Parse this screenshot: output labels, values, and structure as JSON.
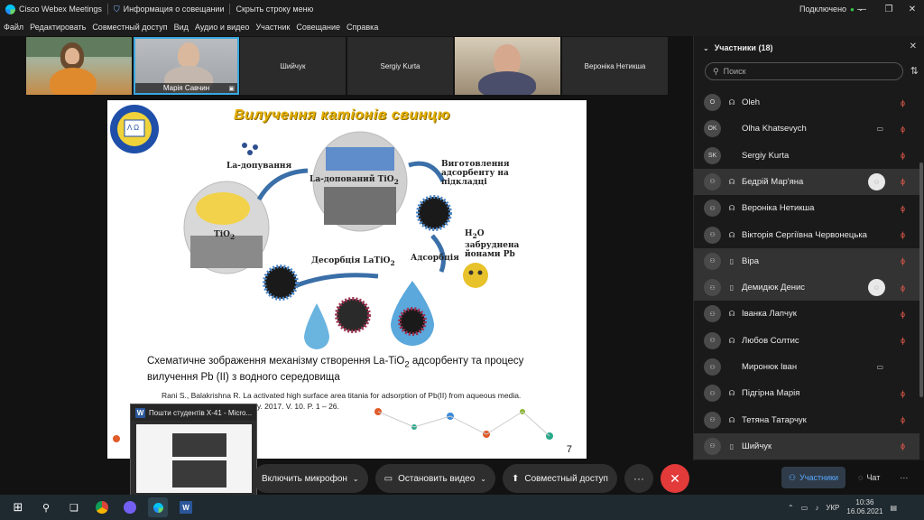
{
  "titlebar": {
    "app_title": "Cisco Webex Meetings",
    "meeting_info": "Информация о совещании",
    "hide_menu": "Скрыть строку меню",
    "status": "Подключено"
  },
  "menu": [
    "Файл",
    "Редактировать",
    "Совместный доступ",
    "Вид",
    "Аудио и видео",
    "Участник",
    "Совещание",
    "Справка"
  ],
  "tiles": [
    {
      "name": "",
      "type": "video"
    },
    {
      "name": "Марія Савчин",
      "type": "video"
    },
    {
      "name": "Шийчук",
      "type": "name"
    },
    {
      "name": "Sergiy Kurta",
      "type": "name"
    },
    {
      "name": "",
      "type": "video"
    },
    {
      "name": "Вероніка Нетикша",
      "type": "name"
    }
  ],
  "slide": {
    "title": "Вилучення катіонів свинцю",
    "label_la_doping": "La-допування",
    "label_la_doped": "La-допований TiO",
    "label_tio2": "TiO",
    "label_adsorbent": "Виготовлення адсорбенту на підкладці",
    "label_h2o": "H",
    "label_h2o_rest": "O забруднена йонами Pb",
    "label_desorption": "Десорбція LaTiO",
    "label_adsorption": "Адсорбція",
    "caption_a": "Схематичне зображення механізму створення La-TiO",
    "caption_b": " адсорбенту та процесу вилучення Pb (II) з водного середовища",
    "reference": "Rani S., Balakrishna R. La activated high surface area titania for adsorption of Pb(II) from aqueous media. Nanotechnology & Chemistry. 2017. V. 10. P. 1 – 26.",
    "page": "7",
    "logo_text": "Λ Ω",
    "subscript_2": "2"
  },
  "thumbnail": {
    "title": "Пошти студентів X-41 - Micro...",
    "icon": "W"
  },
  "controls": {
    "mic": "Включить микрофон",
    "video": "Остановить видео",
    "share": "Совместный доступ",
    "more": "···",
    "end": "✕"
  },
  "panel": {
    "title": "Участники (18)",
    "search_placeholder": "Поиск",
    "participants": [
      {
        "initials": "O",
        "device": "headset",
        "name": "Oleh",
        "muted": true,
        "video": false,
        "chat": false,
        "highlight": false
      },
      {
        "initials": "OK",
        "device": "none",
        "name": "Olha Khatsevych",
        "muted": true,
        "video": true,
        "chat": false,
        "highlight": false
      },
      {
        "initials": "SK",
        "device": "none",
        "name": "Sergiy Kurta",
        "muted": true,
        "video": false,
        "chat": false,
        "highlight": false
      },
      {
        "initials": "",
        "device": "headset",
        "name": "Бедрій Мар'яна",
        "muted": true,
        "video": false,
        "chat": true,
        "highlight": true
      },
      {
        "initials": "",
        "device": "headset",
        "name": "Вероніка Нетикша",
        "muted": true,
        "video": false,
        "chat": false,
        "highlight": false
      },
      {
        "initials": "",
        "device": "headset",
        "name": "Вікторія Сергіївна Червонецька",
        "muted": true,
        "video": false,
        "chat": false,
        "highlight": false
      },
      {
        "initials": "",
        "device": "phone",
        "name": "Віра",
        "muted": true,
        "video": false,
        "chat": false,
        "highlight": true
      },
      {
        "initials": "",
        "device": "phone",
        "name": "Демидюк Денис",
        "muted": true,
        "video": false,
        "chat": true,
        "highlight": true
      },
      {
        "initials": "",
        "device": "headset",
        "name": "Іванка Лапчук",
        "muted": true,
        "video": false,
        "chat": false,
        "highlight": false
      },
      {
        "initials": "",
        "device": "headset",
        "name": "Любов Солтис",
        "muted": true,
        "video": false,
        "chat": false,
        "highlight": false
      },
      {
        "initials": "",
        "device": "none",
        "name": "Миронюк Іван",
        "muted": false,
        "video": true,
        "chat": false,
        "highlight": false
      },
      {
        "initials": "",
        "device": "headset",
        "name": "Підгірна Марія",
        "muted": true,
        "video": false,
        "chat": false,
        "highlight": false
      },
      {
        "initials": "",
        "device": "headset",
        "name": "Тетяна Татарчук",
        "muted": true,
        "video": false,
        "chat": false,
        "highlight": false
      },
      {
        "initials": "",
        "device": "phone",
        "name": "Шийчук",
        "muted": true,
        "video": false,
        "chat": false,
        "highlight": true
      }
    ]
  },
  "panel_tabs": {
    "participants": "Участники",
    "chat": "Чат"
  },
  "tray": {
    "lang": "УКР",
    "time": "10:36",
    "date": "16.06.2021"
  }
}
